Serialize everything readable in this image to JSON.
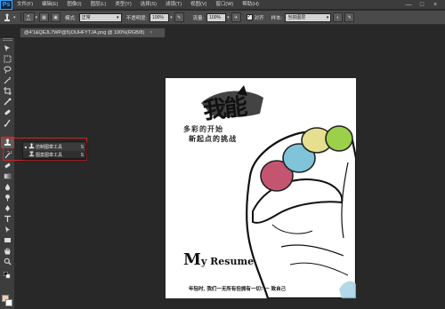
{
  "app": {
    "logo": "Ps"
  },
  "menu": [
    "文件(F)",
    "编辑(E)",
    "图像(I)",
    "图层(L)",
    "类型(Y)",
    "选择(S)",
    "滤镜(T)",
    "视图(V)",
    "窗口(W)",
    "帮助(H)"
  ],
  "window_controls": {
    "minimize": "—",
    "restore": "□",
    "close": "×"
  },
  "options": {
    "brush_size": "21",
    "mode_label": "模式:",
    "mode_value": "正常",
    "opacity_label": "不透明度:",
    "opacity_value": "100%",
    "flow_label": "流量:",
    "flow_value": "100%",
    "aligned_label": "对齐",
    "aligned_checked": true,
    "sample_label": "样本:",
    "sample_value": "当前图层"
  },
  "document_tab": {
    "title": "@4'1&QEJL7WP@5)OUHFYTJA.png @ 100%(RGB/8)",
    "close": "×"
  },
  "flyout": {
    "items": [
      {
        "label": "仿制图章工具",
        "shortcut": "S",
        "selected": true
      },
      {
        "label": "图案图章工具",
        "shortcut": "S",
        "selected": false
      }
    ]
  },
  "poster": {
    "title": "我能",
    "line1": "多彩的开始",
    "line2": "新起点的挑战",
    "heading_big": "M",
    "heading_rest": "y Resume",
    "footer": "年轻时, 我们一无所有但拥有一切!   一 致自己"
  },
  "colors": {
    "accent_red": "#c62828",
    "ps_blue": "#35a6ff",
    "finger_yellow": "#e6df90",
    "finger_green": "#9ccf4a",
    "finger_blue": "#7fc4d8",
    "finger_pink": "#c45570"
  }
}
